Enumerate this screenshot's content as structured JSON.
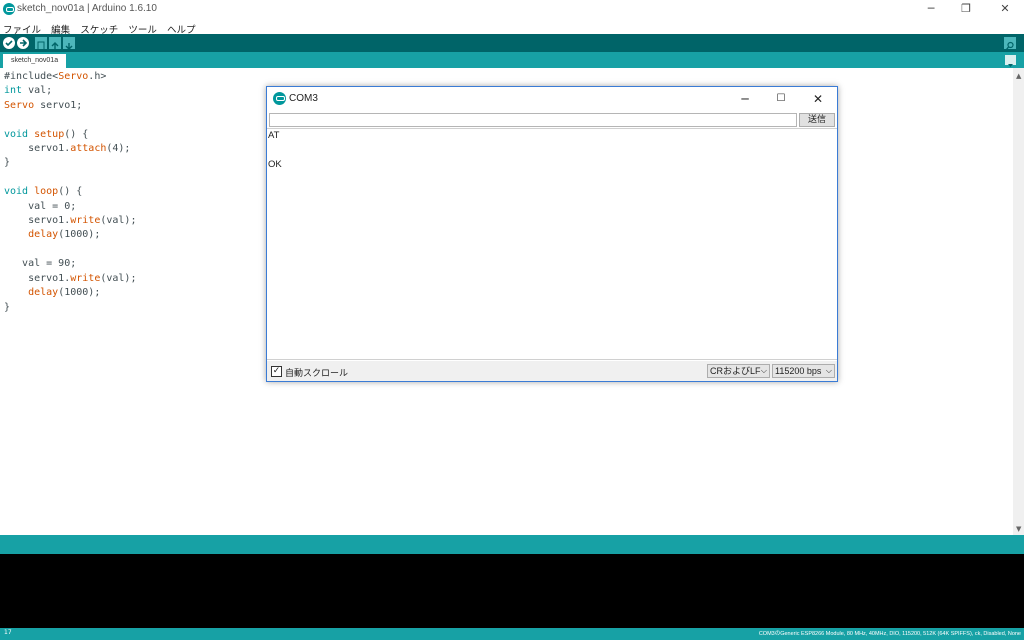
{
  "window": {
    "title": "sketch_nov01a | Arduino 1.6.10",
    "minimize": "─",
    "restore": "❐",
    "close": "✕"
  },
  "menu": [
    "ファイル",
    "編集",
    "スケッチ",
    "ツール",
    "ヘルプ"
  ],
  "tab": {
    "label": "sketch_nov01a"
  },
  "code_lines": [
    "#include<Servo.h>",
    "int val;",
    "Servo servo1;",
    "",
    "void setup() {",
    "    servo1.attach(4);",
    "}",
    "",
    "void loop() {",
    "    val = 0;",
    "    servo1.write(val);",
    "    delay(1000);",
    "",
    "   val = 90;",
    "    servo1.write(val);",
    "    delay(1000);",
    "}"
  ],
  "serial_monitor": {
    "title": "COM3",
    "input_value": "",
    "send_label": "送信",
    "output_lines": [
      "AT",
      "",
      "OK"
    ],
    "autoscroll_label": "自動スクロール",
    "autoscroll_checked": "✓",
    "line_ending": "CRおよびLF",
    "baud_rate": "115200 bps"
  },
  "status": {
    "line_number": "17",
    "board_info": "COM3のGeneric ESP8266 Module, 80 MHz, 40MHz, DIO, 115200, 512K (64K SPIFFS), ck, Disabled, None"
  },
  "colors": {
    "toolbar": "#006468",
    "accent": "#17a1a5",
    "keyword": "#00979c",
    "type": "#d35400"
  }
}
